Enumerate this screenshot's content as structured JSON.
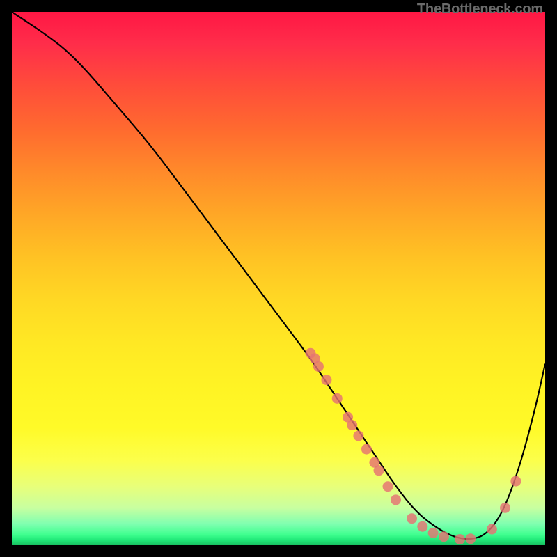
{
  "watermark": "TheBottleneck.com",
  "chart_data": {
    "type": "line",
    "title": "",
    "xlabel": "",
    "ylabel": "",
    "xlim": [
      0,
      100
    ],
    "ylim": [
      0,
      100
    ],
    "grid": false,
    "legend": false,
    "series": [
      {
        "name": "bottleneck-curve",
        "x": [
          0,
          3,
          6,
          10,
          14,
          20,
          26,
          32,
          38,
          44,
          50,
          56,
          60,
          64,
          68,
          72,
          76,
          80,
          83,
          86,
          89,
          92,
          95,
          98,
          100
        ],
        "y": [
          100,
          98,
          96,
          93,
          89,
          82,
          75,
          67,
          59,
          51,
          43,
          35,
          29,
          23,
          17,
          11,
          6,
          3,
          1.5,
          1,
          2,
          6,
          14,
          25,
          34
        ]
      }
    ],
    "scatter": {
      "name": "marker-points",
      "points": [
        {
          "x": 56,
          "y": 36
        },
        {
          "x": 56.8,
          "y": 35
        },
        {
          "x": 57.5,
          "y": 33.5
        },
        {
          "x": 59,
          "y": 31
        },
        {
          "x": 61,
          "y": 27.5
        },
        {
          "x": 63,
          "y": 24
        },
        {
          "x": 63.8,
          "y": 22.5
        },
        {
          "x": 65,
          "y": 20.5
        },
        {
          "x": 66.5,
          "y": 18
        },
        {
          "x": 68,
          "y": 15.5
        },
        {
          "x": 68.8,
          "y": 14
        },
        {
          "x": 70.5,
          "y": 11
        },
        {
          "x": 72,
          "y": 8.5
        },
        {
          "x": 75,
          "y": 5
        },
        {
          "x": 77,
          "y": 3.5
        },
        {
          "x": 79,
          "y": 2.3
        },
        {
          "x": 81,
          "y": 1.6
        },
        {
          "x": 84,
          "y": 1.1
        },
        {
          "x": 86,
          "y": 1.2
        },
        {
          "x": 90,
          "y": 3
        },
        {
          "x": 92.5,
          "y": 7
        },
        {
          "x": 94.5,
          "y": 12
        }
      ]
    },
    "colors": {
      "curve": "#000000",
      "dot": "#e57373",
      "gradient_top": "#ff1744",
      "gradient_bottom": "#18c060"
    }
  }
}
